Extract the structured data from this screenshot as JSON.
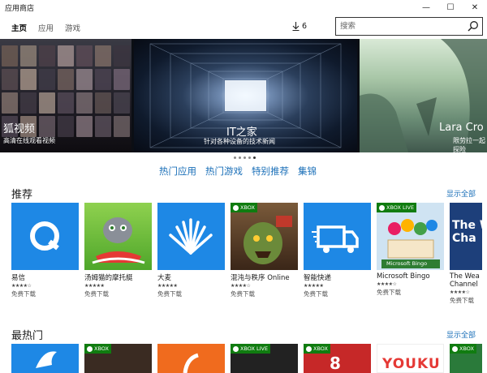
{
  "window": {
    "title": "应用商店",
    "controls": [
      "—",
      "☐",
      "✕"
    ]
  },
  "nav": {
    "tabs": [
      {
        "label": "主页",
        "active": true
      },
      {
        "label": "应用",
        "active": false
      },
      {
        "label": "游戏",
        "active": false
      }
    ],
    "downloads_count": "6",
    "search_placeholder": "搜索"
  },
  "hero": {
    "slides": [
      {
        "title": "狐视频",
        "subtitle": "高清在线观看视频"
      },
      {
        "title": "IT之家",
        "subtitle": "针对各种设备的技术新闻"
      },
      {
        "title": "Lara Cro",
        "subtitle": "限劳拉一起探险"
      }
    ],
    "active_dot": 4,
    "dot_count": 5
  },
  "categories": [
    "热门应用",
    "热门游戏",
    "特别推荐",
    "集锦"
  ],
  "recommended": {
    "title": "推荐",
    "more": "显示全部",
    "apps": [
      {
        "name": "易信",
        "rating": "★★★★☆",
        "price": "免费下载",
        "color": "#1e88e5",
        "icon": "yixin-icon"
      },
      {
        "name": "汤姆猫的摩托艇",
        "rating": "★★★★★",
        "price": "免费下载",
        "color": "#6bbf3a",
        "icon": "tom-cat-icon"
      },
      {
        "name": "大麦",
        "rating": "★★★★★",
        "price": "免费下载",
        "color": "#1e88e5",
        "icon": "damai-icon"
      },
      {
        "name": "混沌与秩序 Online",
        "rating": "★★★★☆",
        "price": "免费下载",
        "color": "#5b3b2a",
        "icon": "chaos-order-icon",
        "badge": "XBOX"
      },
      {
        "name": "智能快递",
        "rating": "★★★★★",
        "price": "免费下载",
        "color": "#1e88e5",
        "icon": "delivery-truck-icon"
      },
      {
        "name": "Microsoft Bingo",
        "rating": "★★★★☆",
        "price": "免费下载",
        "color": "#b7d6ee",
        "icon": "bingo-icon",
        "badge": "XBOX LIVE",
        "badge_text": "Microsoft Bingo"
      },
      {
        "name": "The Wea Channel",
        "rating": "★★★★☆",
        "price": "免费下载",
        "color": "#1d3f7a",
        "icon": "weather-channel-icon",
        "tile_text": "The We Cha"
      }
    ]
  },
  "hot": {
    "title": "最热门",
    "more": "显示全部",
    "apps": [
      {
        "color": "#1e88e5",
        "icon": "bird-icon"
      },
      {
        "color": "#3a2b22",
        "icon": "game-icon",
        "badge": "XBOX"
      },
      {
        "color": "#f06b1e",
        "icon": "orange-app-icon"
      },
      {
        "color": "#222222",
        "icon": "game-icon",
        "badge": "XBOX LIVE"
      },
      {
        "color": "#c62828",
        "icon": "racing-icon",
        "badge": "XBOX",
        "tile_text": "8"
      },
      {
        "color": "#ffffff",
        "icon": "youku-icon",
        "tile_text": "YOUKU"
      },
      {
        "color": "#2a7a3a",
        "icon": "game-icon",
        "badge": "XBOX"
      }
    ]
  }
}
